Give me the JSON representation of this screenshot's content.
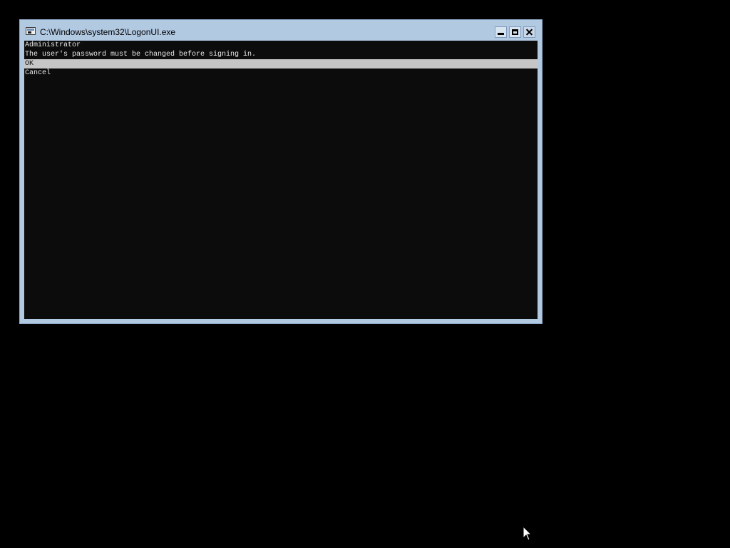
{
  "window": {
    "title": "C:\\Windows\\system32\\LogonUI.exe",
    "app_icon": "console-window-icon",
    "controls": {
      "minimize": "minimize-icon",
      "maximize": "maximize-icon",
      "close": "close-icon"
    }
  },
  "console": {
    "user": "Administrator",
    "message": "The user's password must be changed before signing in.",
    "options": [
      {
        "label": "OK",
        "selected": true
      },
      {
        "label": "Cancel",
        "selected": false
      }
    ]
  },
  "colors": {
    "desktop": "#000000",
    "window_frame": "#b2c9e2",
    "console_bg": "#0c0c0c",
    "console_text": "#e8e8e8",
    "selection_bg": "#c6c6c6"
  },
  "cursor": "mouse-pointer-icon"
}
